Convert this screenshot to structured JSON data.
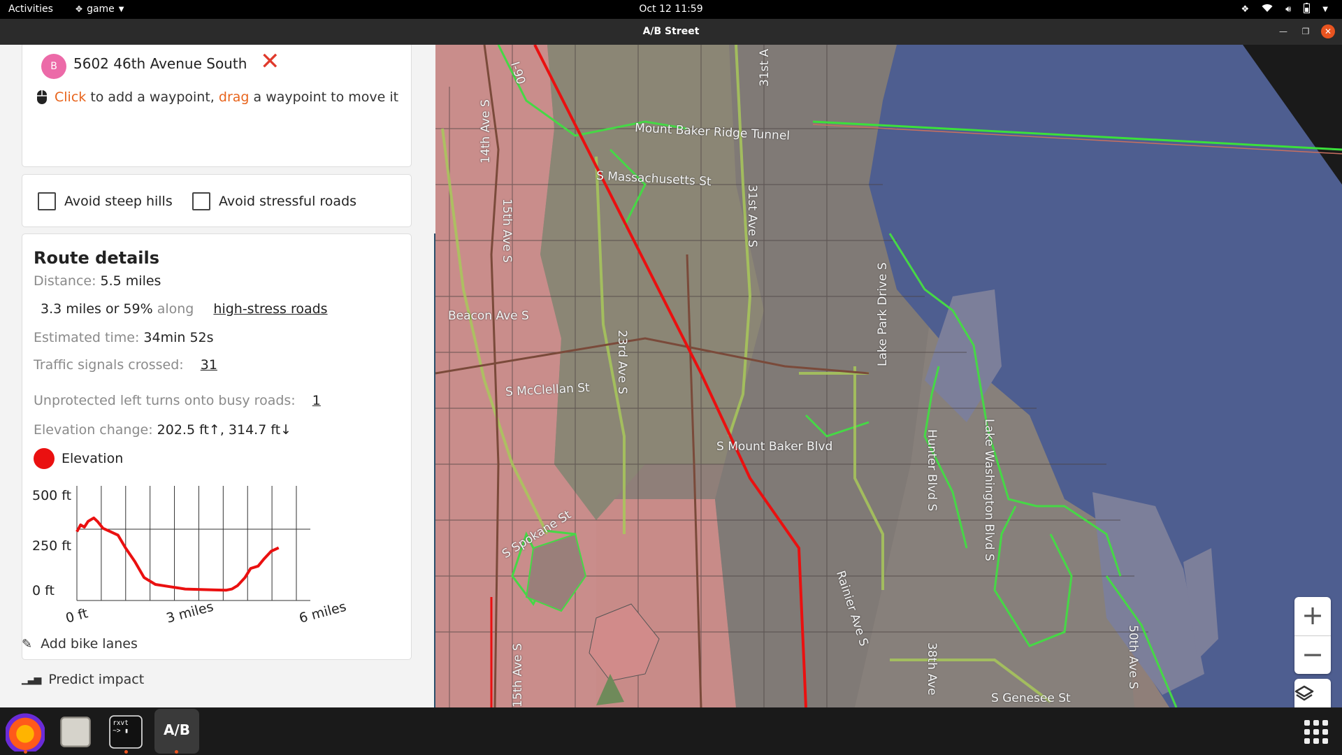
{
  "topbar": {
    "activities": "Activities",
    "app_menu": "game",
    "clock": "Oct 12  11:59"
  },
  "window": {
    "title": "A/B Street"
  },
  "route": {
    "destination_badge": "B",
    "destination_address": "5602 46th Avenue South",
    "hint_click": "Click",
    "hint_mid": " to add a waypoint, ",
    "hint_drag": "drag",
    "hint_end": " a waypoint to move it"
  },
  "options": {
    "avoid_hills": "Avoid steep hills",
    "avoid_stressful": "Avoid stressful roads"
  },
  "details": {
    "title": "Route details",
    "distance_label": "Distance:",
    "distance_value": "5.5 miles",
    "stress_prefix": "3.3 miles or 59%",
    "stress_along": "along",
    "stress_link": "high-stress roads",
    "time_label": "Estimated time:",
    "time_value": "34min 52s",
    "signals_label": "Traffic signals crossed:",
    "signals_value": "31",
    "left_turns_label": "Unprotected left turns onto busy roads:",
    "left_turns_value": "1",
    "elev_label": "Elevation change:",
    "elev_value": "202.5 ft↑, 314.7 ft↓",
    "legend": "Elevation"
  },
  "chart_data": {
    "type": "line",
    "title": "",
    "xlabel": "",
    "ylabel": "",
    "y_tick_labels": [
      "500 ft",
      "250 ft",
      "0 ft"
    ],
    "x_tick_labels": [
      "0 ft",
      "3 miles",
      "6 miles"
    ],
    "ylim": [
      0,
      500
    ],
    "xlim": [
      0,
      5.5
    ],
    "color": "#ea1010",
    "series": [
      {
        "x": [
          0,
          0.1,
          0.2,
          0.3,
          0.45,
          0.55,
          0.7,
          0.9,
          1.1,
          1.3,
          1.55,
          1.8,
          2.1,
          2.5,
          2.9,
          3.3,
          3.7,
          4.0,
          4.15,
          4.3,
          4.5,
          4.65,
          4.85,
          5.0,
          5.2,
          5.4
        ],
        "y": [
          300,
          330,
          320,
          345,
          360,
          345,
          315,
          300,
          285,
          230,
          170,
          100,
          70,
          60,
          50,
          48,
          46,
          45,
          50,
          65,
          100,
          140,
          150,
          180,
          215,
          230
        ]
      }
    ]
  },
  "tools": {
    "add_bike_lanes": "Add bike lanes",
    "predict_impact": "Predict impact"
  },
  "map": {
    "labels": {
      "i90": "I-90",
      "tunnel": "Mount Baker Ridge Tunnel",
      "mass": "S Massachusetts St",
      "ave14": "14th Ave S",
      "ave15": "15th Ave S",
      "ave31": "31st Ave S",
      "ave31b": "31st A",
      "beacon": "Beacon Ave S",
      "ave23": "23rd Ave S",
      "lakepark": "Lake Park Drive S",
      "mcclellan": "S McClellan St",
      "mtbaker": "S Mount Baker Blvd",
      "hunter": "Hunter Blvd S",
      "lakewash": "Lake Washington Blvd S",
      "spokane": "S Spokane St",
      "rainier": "Rainier Ave S",
      "ave15b": "15th Ave S",
      "ave38": "38th Ave",
      "ave50": "50th Ave S",
      "genesee": "S Genesee St"
    }
  }
}
